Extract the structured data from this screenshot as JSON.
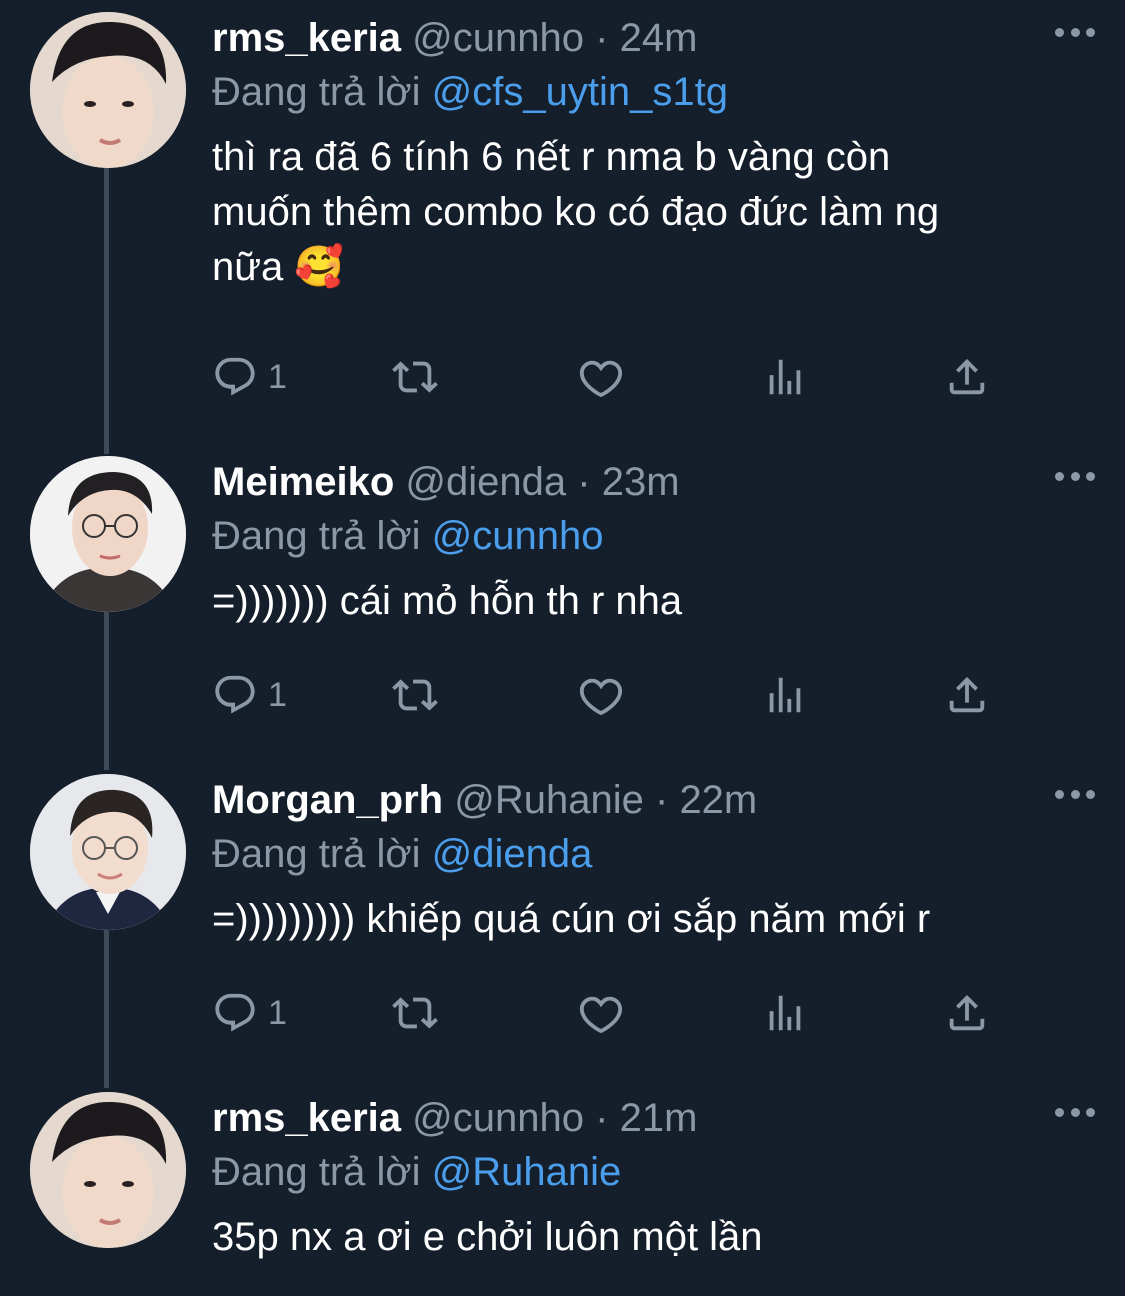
{
  "reply_prefix": "Đang trả lời",
  "colors": {
    "background": "#151f2b",
    "name": "#ffffff",
    "muted": "#8b98a5",
    "mention": "#4a9eeb",
    "thread_line": "#3d4a58"
  },
  "tweets": [
    {
      "name": "rms_keria",
      "handle": "@cunnho",
      "separator": "·",
      "time": "24m",
      "reply_to": "@cfs_uytin_s1tg",
      "text_lines": [
        "thì ra đã 6 tính 6 nết r nma b vàng còn",
        "muốn thêm combo ko có đạo đức làm ng",
        "nữa 🥰"
      ],
      "reply_count": "1"
    },
    {
      "name": "Meimeiko",
      "handle": "@dienda",
      "separator": "·",
      "time": "23m",
      "reply_to": "@cunnho",
      "text_lines": [
        "=))))))) cái mỏ hỗn th r nha"
      ],
      "reply_count": "1"
    },
    {
      "name": "Morgan_prh",
      "handle": "@Ruhanie",
      "separator": "·",
      "time": "22m",
      "reply_to": "@dienda",
      "text_lines": [
        "=))))))))) khiếp quá cún ơi sắp năm mới r"
      ],
      "reply_count": "1"
    },
    {
      "name": "rms_keria",
      "handle": "@cunnho",
      "separator": "·",
      "time": "21m",
      "reply_to": "@Ruhanie",
      "text_lines": [
        "35p nx a ơi e chởi luôn một lần"
      ],
      "reply_count": ""
    }
  ],
  "icons": {
    "reply": "reply-icon",
    "retweet": "retweet-icon",
    "like": "heart-icon",
    "analytics": "analytics-icon",
    "share": "share-icon",
    "more": "more-icon"
  }
}
